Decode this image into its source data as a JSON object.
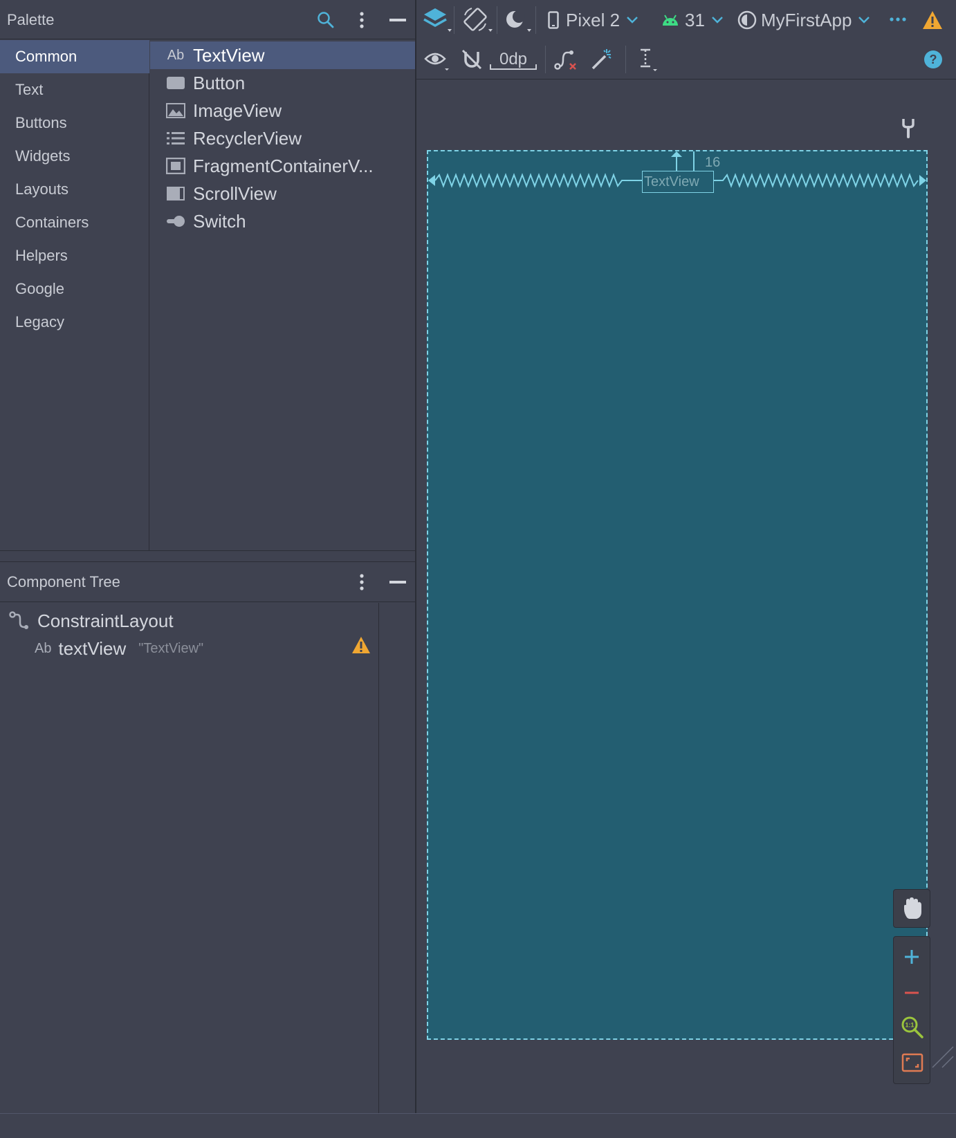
{
  "palette": {
    "title": "Palette",
    "categories": [
      "Common",
      "Text",
      "Buttons",
      "Widgets",
      "Layouts",
      "Containers",
      "Helpers",
      "Google",
      "Legacy"
    ],
    "selected_category": "Common",
    "items": [
      {
        "label": "TextView",
        "icon": "text-ab-icon"
      },
      {
        "label": "Button",
        "icon": "button-icon"
      },
      {
        "label": "ImageView",
        "icon": "image-icon"
      },
      {
        "label": "RecyclerView",
        "icon": "list-icon"
      },
      {
        "label": "FragmentContainerV...",
        "icon": "fragment-icon"
      },
      {
        "label": "ScrollView",
        "icon": "scrollview-icon"
      },
      {
        "label": "Switch",
        "icon": "switch-icon"
      }
    ],
    "selected_item": "TextView"
  },
  "tree": {
    "title": "Component Tree",
    "root": "ConstraintLayout",
    "child_prefix": "Ab",
    "child_name": "textView",
    "child_text": "\"TextView\""
  },
  "toolbar": {
    "device": "Pixel 2",
    "api": "31",
    "theme": "MyFirstApp",
    "margin": "0dp"
  },
  "canvas": {
    "textview_label": "TextView",
    "margin_value": "16"
  },
  "colors": {
    "accent": "#4fb3d9",
    "warning": "#f0a732",
    "selection": "#4c5a7d",
    "blueprint": "#235e71",
    "android_green": "#3ddc84",
    "zoom_out": "#d9534f",
    "zoom_fit": "#9bc53d",
    "screen_toggle": "#e07b53"
  }
}
